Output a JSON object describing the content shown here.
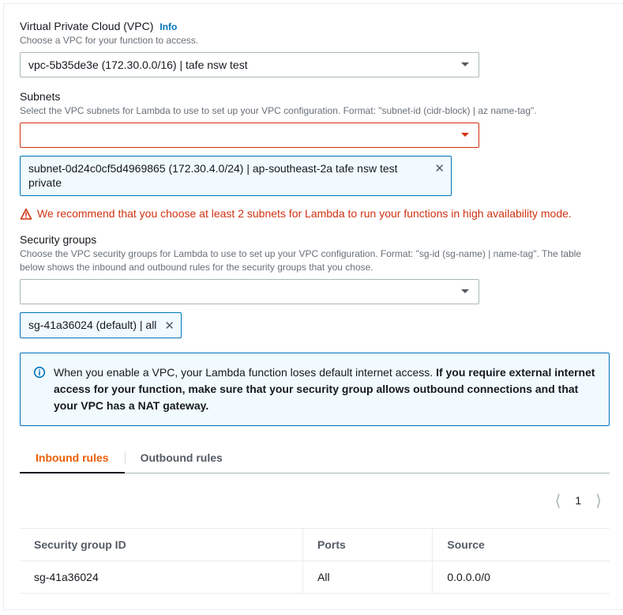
{
  "vpc": {
    "label": "Virtual Private Cloud (VPC)",
    "info": "Info",
    "desc": "Choose a VPC for your function to access.",
    "selected": "vpc-5b35de3e (172.30.0.0/16) | tafe nsw test"
  },
  "subnets": {
    "label": "Subnets",
    "desc": "Select the VPC subnets for Lambda to use to set up your VPC configuration. Format: \"subnet-id (cidr-block) | az name-tag\".",
    "chip": "subnet-0d24c0cf5d4969865 (172.30.4.0/24) | ap-southeast-2a tafe nsw test private",
    "warning": "We recommend that you choose at least 2 subnets for Lambda to run your functions in high availability mode."
  },
  "securityGroups": {
    "label": "Security groups",
    "desc": "Choose the VPC security groups for Lambda to use to set up your VPC configuration. Format: \"sg-id (sg-name) | name-tag\". The table below shows the inbound and outbound rules for the security groups that you chose.",
    "chip": "sg-41a36024 (default) | all"
  },
  "infoBox": {
    "prefix": "When you enable a VPC, your Lambda function loses default internet access. ",
    "bold": "If you require external internet access for your function, make sure that your security group allows outbound connections and that your VPC has a NAT gateway."
  },
  "tabs": {
    "inbound": "Inbound rules",
    "outbound": "Outbound rules"
  },
  "pager": {
    "page": "1"
  },
  "table": {
    "headers": {
      "sgid": "Security group ID",
      "ports": "Ports",
      "source": "Source"
    },
    "row": {
      "sgid": "sg-41a36024",
      "ports": "All",
      "source": "0.0.0.0/0"
    }
  }
}
